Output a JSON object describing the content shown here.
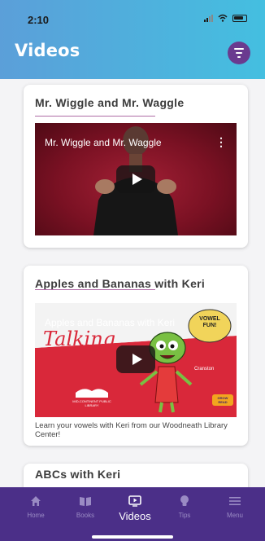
{
  "status_bar": {
    "time": "2:10"
  },
  "header": {
    "title": "Videos"
  },
  "videos": [
    {
      "title": "Mr. Wiggle and Mr. Waggle",
      "video_title": "Mr. Wiggle and Mr. Waggle",
      "description": ""
    },
    {
      "title": "Apples and Bananas with Keri",
      "video_title": "Apples and Bananas with Keri",
      "description": "Learn your vowels with Keri from our Woodneath Library Center!",
      "thumb_text": {
        "talking": "Talking",
        "vowel_bubble": "VOWEL FUN!",
        "character": "Cranston",
        "library": "MID-CONTINENT PUBLIC LIBRARY",
        "brand": "GROW READ"
      }
    },
    {
      "title": "ABCs with Keri"
    }
  ],
  "bottom_nav": {
    "items": [
      {
        "label": "Home",
        "icon": "home-icon"
      },
      {
        "label": "Books",
        "icon": "book-icon"
      },
      {
        "label": "Videos",
        "icon": "video-icon"
      },
      {
        "label": "Tips",
        "icon": "lightbulb-icon"
      },
      {
        "label": "Menu",
        "icon": "menu-icon"
      }
    ],
    "active": "Videos"
  },
  "colors": {
    "header_start": "#5b9fd9",
    "header_end": "#44bfe0",
    "nav_bg": "#4b2f88",
    "filter_button": "#6a3a8f",
    "title_rule": "#b06ca6"
  }
}
